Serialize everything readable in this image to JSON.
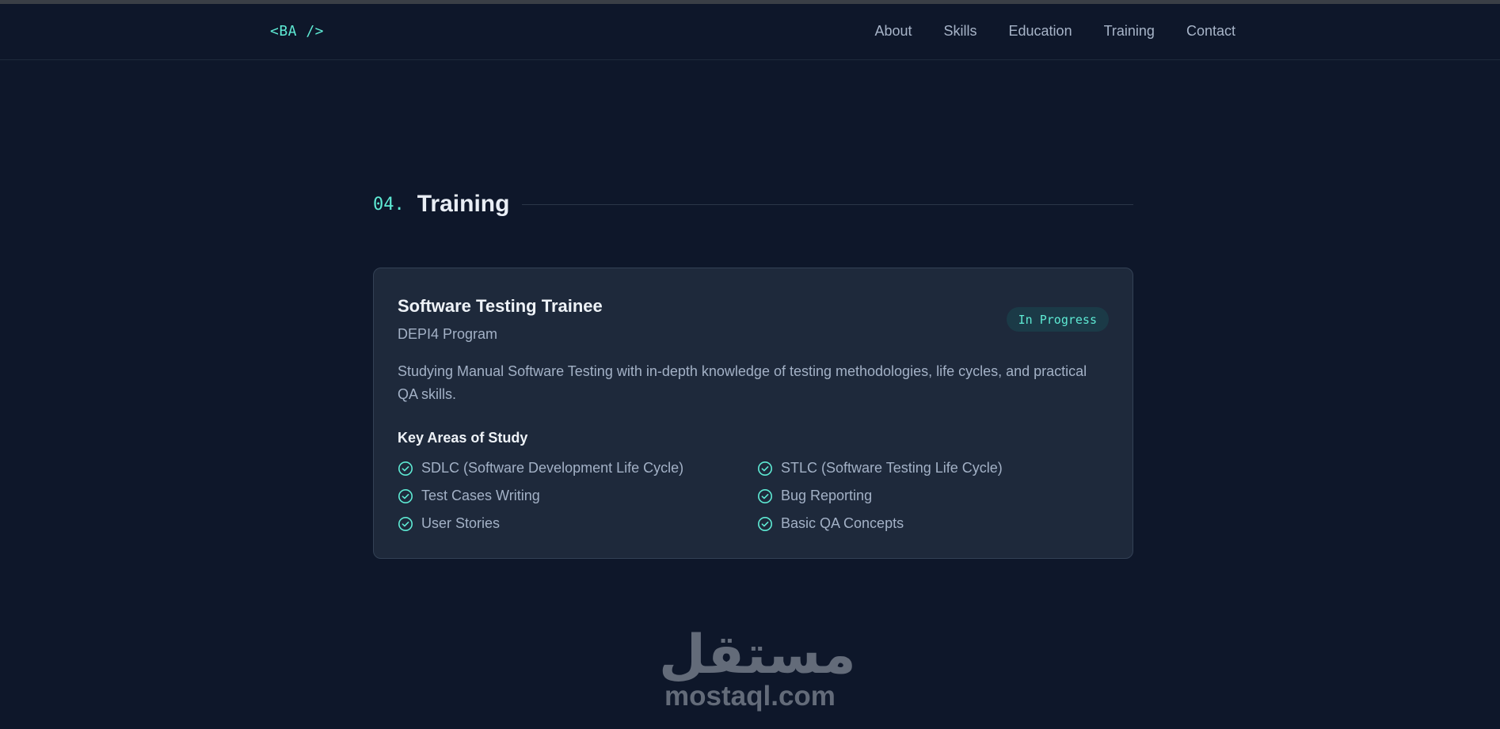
{
  "header": {
    "logo": "<BA />",
    "nav": [
      "About",
      "Skills",
      "Education",
      "Training",
      "Contact"
    ]
  },
  "section": {
    "number": "04.",
    "title": "Training"
  },
  "card": {
    "title": "Software Testing Trainee",
    "subtitle": "DEPI4 Program",
    "badge": "In Progress",
    "description": "Studying Manual Software Testing with in-depth knowledge of testing methodologies, life cycles, and practical QA skills.",
    "areas_title": "Key Areas of Study",
    "areas": [
      "SDLC (Software Development Life Cycle)",
      "STLC (Software Testing Life Cycle)",
      "Test Cases Writing",
      "Bug Reporting",
      "User Stories",
      "Basic QA Concepts"
    ],
    "icon": "check-circle-icon"
  },
  "watermark": {
    "arabic": "مستقل",
    "latin": "mostaql.com"
  },
  "colors": {
    "background": "#0e172a",
    "card": "#1e293b",
    "accent": "#5eead4",
    "muted_text": "#a3b1c6"
  }
}
